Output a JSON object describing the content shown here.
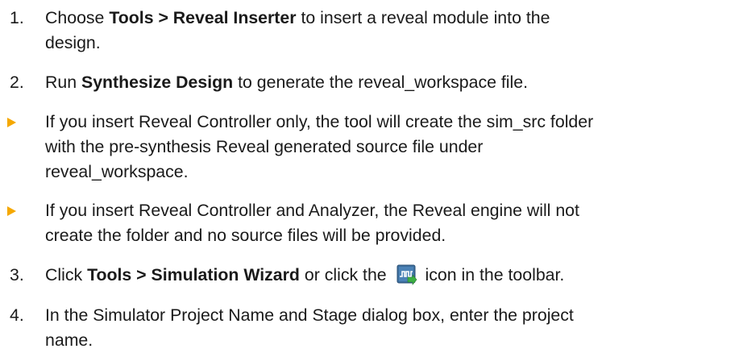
{
  "steps": [
    {
      "marker": "1.",
      "pre": "Choose ",
      "bold": "Tools > Reveal Inserter",
      "post_line1": " to insert a reveal module into the",
      "line2": "design."
    },
    {
      "marker": "2.",
      "pre": "Run ",
      "bold": "Synthesize Design",
      "post": " to generate the reveal_workspace file."
    },
    {
      "marker": "3.",
      "pre": "Click ",
      "bold": "Tools > Simulation Wizard",
      "mid": " or click the ",
      "icon": "simulation-wizard-icon",
      "post": " icon in the toolbar."
    },
    {
      "marker": "4.",
      "line1": "In the Simulator Project Name and Stage dialog box, enter the project",
      "line2": "name."
    }
  ],
  "bullets": [
    {
      "lines": [
        "If you insert Reveal Controller only, the tool will create the sim_src folder",
        "with the pre-synthesis Reveal generated source file under",
        "reveal_workspace."
      ]
    },
    {
      "lines": [
        "If you insert Reveal Controller and Analyzer, the Reveal engine will not",
        "create the folder and no source files will be provided."
      ]
    }
  ],
  "colors": {
    "bullet": "#f5a800",
    "text": "#1a1a1a",
    "icon_bg": "#3d6f9e",
    "icon_arrow": "#3cb043"
  }
}
